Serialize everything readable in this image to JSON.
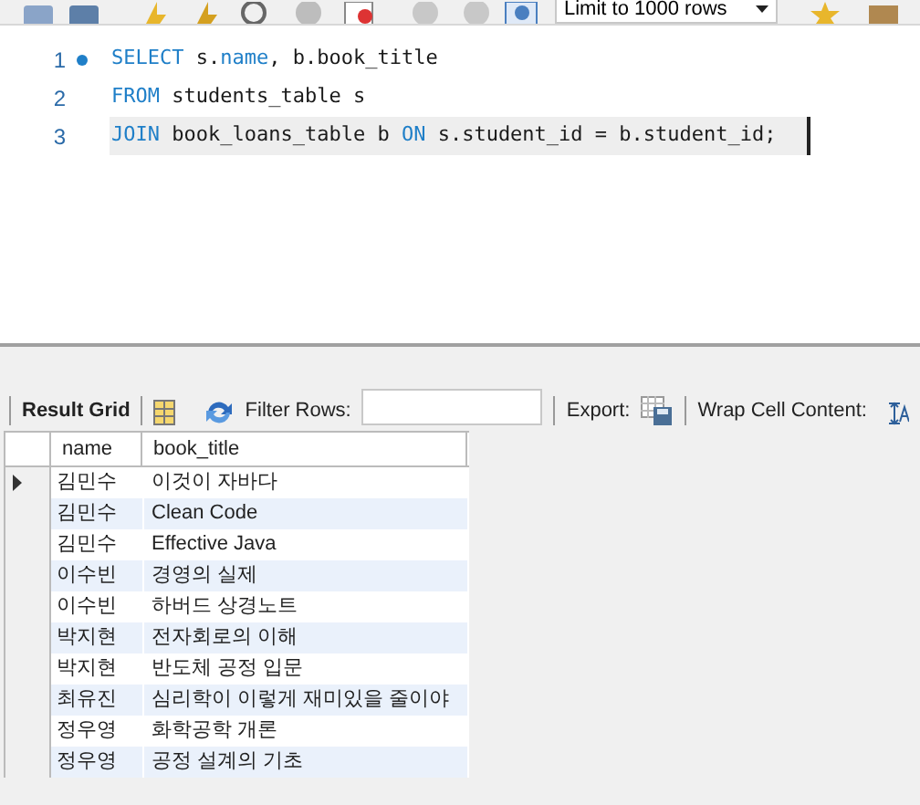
{
  "toolbar": {
    "limit_combo": "Limit to 1000 rows"
  },
  "editor": {
    "lines": [
      {
        "number": "1",
        "marker": true,
        "current": false,
        "tokens": [
          {
            "text": "SELECT",
            "kind": "keyword"
          },
          {
            "text": " s.",
            "kind": "plain"
          },
          {
            "text": "name",
            "kind": "keyword"
          },
          {
            "text": ", b.book_title",
            "kind": "plain"
          }
        ]
      },
      {
        "number": "2",
        "marker": false,
        "current": false,
        "tokens": [
          {
            "text": "FROM",
            "kind": "keyword"
          },
          {
            "text": " students_table s",
            "kind": "plain"
          }
        ]
      },
      {
        "number": "3",
        "marker": false,
        "current": true,
        "tokens": [
          {
            "text": "JOIN",
            "kind": "keyword"
          },
          {
            "text": " book_loans_table b ",
            "kind": "plain"
          },
          {
            "text": "ON",
            "kind": "keyword"
          },
          {
            "text": " s.student_id = b.student_id;",
            "kind": "plain"
          }
        ]
      }
    ]
  },
  "result_toolbar": {
    "result_grid": "Result Grid",
    "filter_label": "Filter Rows:",
    "export_label": "Export:",
    "wrap_label": "Wrap Cell Content:"
  },
  "table": {
    "columns": [
      "name",
      "book_title"
    ],
    "rows": [
      {
        "selected": true,
        "cells": [
          "김민수",
          "이것이 자바다"
        ]
      },
      {
        "selected": false,
        "cells": [
          "김민수",
          "Clean Code"
        ]
      },
      {
        "selected": false,
        "cells": [
          "김민수",
          "Effective Java"
        ]
      },
      {
        "selected": false,
        "cells": [
          "이수빈",
          "경영의 실제"
        ]
      },
      {
        "selected": false,
        "cells": [
          "이수빈",
          "하버드 상경노트"
        ]
      },
      {
        "selected": false,
        "cells": [
          "박지현",
          "전자회로의 이해"
        ]
      },
      {
        "selected": false,
        "cells": [
          "박지현",
          "반도체 공정 입문"
        ]
      },
      {
        "selected": false,
        "cells": [
          "최유진",
          "심리학이 이렇게 재미있을 줄이야"
        ]
      },
      {
        "selected": false,
        "cells": [
          "정우영",
          "화학공학 개론"
        ]
      },
      {
        "selected": false,
        "cells": [
          "정우영",
          "공정 설계의 기초"
        ]
      }
    ]
  }
}
